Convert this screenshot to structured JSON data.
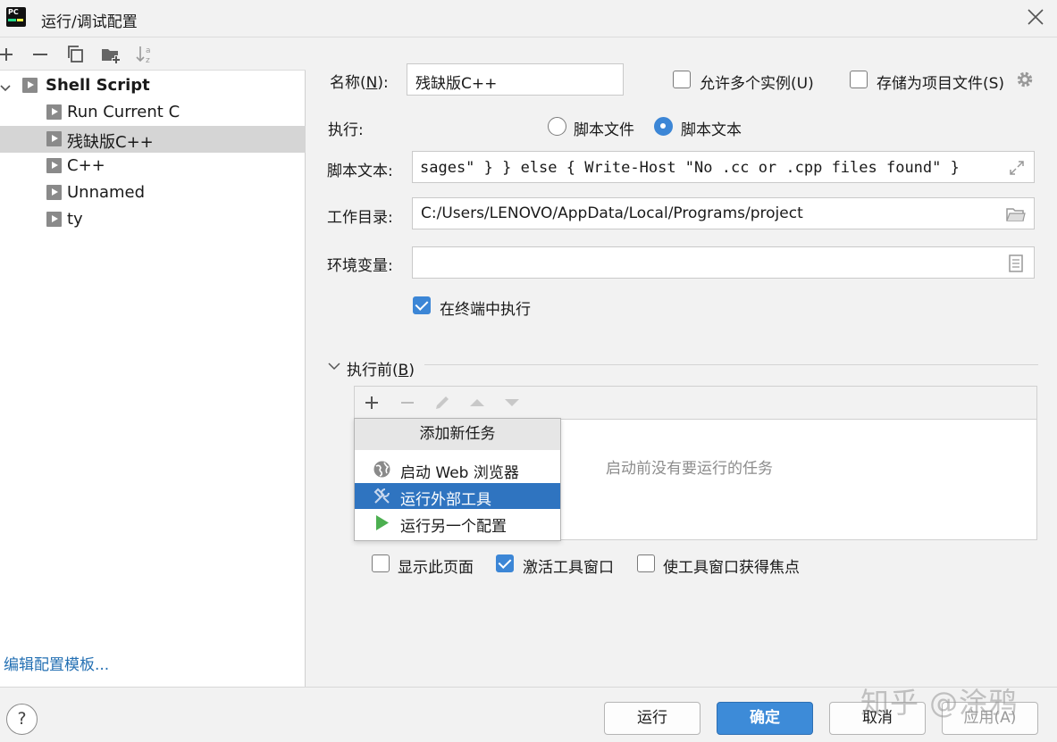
{
  "window": {
    "title": "运行/调试配置",
    "close_icon": "close-icon"
  },
  "left_toolbar": {
    "icons": [
      "add-icon",
      "remove-icon",
      "copy-icon",
      "new-folder-icon",
      "sort-icon"
    ]
  },
  "tree": {
    "group": {
      "label": "Shell Script",
      "expanded": true
    },
    "items": [
      {
        "label": "Run Current C",
        "selected": false
      },
      {
        "label": "残缺版C++",
        "selected": true
      },
      {
        "label": "C++",
        "selected": false
      },
      {
        "label": "Unnamed",
        "selected": false
      },
      {
        "label": "ty",
        "selected": false
      }
    ]
  },
  "edit_templates_link": "编辑配置模板...",
  "form": {
    "name_label_pre": "名称(",
    "name_label_key": "N",
    "name_label_post": "):",
    "name_value": "残缺版C++",
    "allow_multiple": {
      "label": "允许多个实例(U)",
      "checked": false
    },
    "store_as_file": {
      "label": "存储为项目文件(S)",
      "checked": false
    },
    "execute_label": "执行:",
    "radio_script_file": {
      "label": "脚本文件",
      "checked": false
    },
    "radio_script_text": {
      "label": "脚本文本",
      "checked": true
    },
    "script_text_label": "脚本文本:",
    "script_text_value": "sages\" } } else { Write-Host \"No .cc or .cpp files found\" }",
    "workdir_label": "工作目录:",
    "workdir_value": "C:/Users/LENOVO/AppData/Local/Programs/project",
    "env_label": "环境变量:",
    "env_value": "",
    "run_in_terminal": {
      "label": "在终端中执行",
      "checked": true
    }
  },
  "before_launch": {
    "title_pre": "执行前(",
    "title_key": "B",
    "title_post": ")",
    "toolbar_icons": [
      "add-icon",
      "remove-icon",
      "edit-icon",
      "move-up-icon",
      "move-down-icon"
    ],
    "empty_text": "启动前没有要运行的任务",
    "popup": {
      "header": "添加新任务",
      "items": [
        {
          "label": "启动 Web 浏览器",
          "icon": "globe-icon",
          "selected": false
        },
        {
          "label": "运行外部工具",
          "icon": "tools-icon",
          "selected": true
        },
        {
          "label": "运行另一个配置",
          "icon": "run-icon",
          "selected": false
        }
      ]
    },
    "show_page": {
      "label": "显示此页面",
      "checked": false
    },
    "activate_tool_window": {
      "label": "激活工具窗口",
      "checked": true
    },
    "focus_tool_window": {
      "label": "使工具窗口获得焦点",
      "checked": false
    }
  },
  "buttons": {
    "run": "运行",
    "ok": "确定",
    "cancel": "取消",
    "apply": "应用(A)"
  },
  "watermark": "知乎 @涂鸦",
  "colors": {
    "accent": "#3d8bd8",
    "selection": "#2f74c0",
    "link": "#2470b3"
  }
}
